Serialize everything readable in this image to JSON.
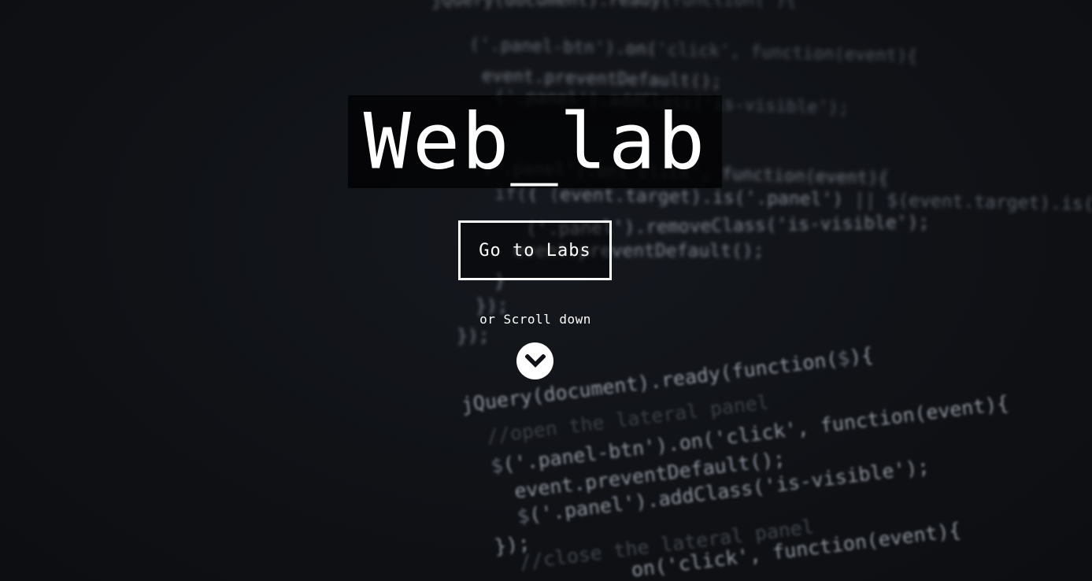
{
  "hero": {
    "title": "Web_lab",
    "cta_label": "Go to Labs",
    "scroll_hint": "or Scroll down",
    "scroll_icon": "chevron-down-icon"
  },
  "colors": {
    "background": "#101217",
    "text": "#ffffff",
    "title_box": "#000000"
  }
}
